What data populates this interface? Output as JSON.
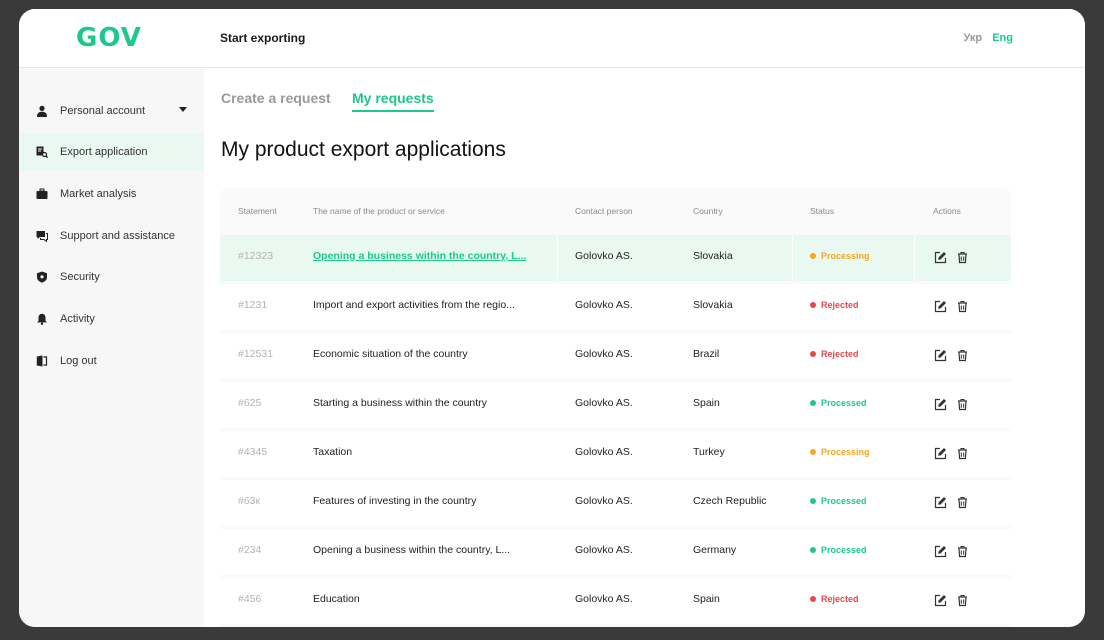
{
  "header": {
    "logo": "GOV",
    "title": "Start exporting",
    "lang_ukr": "Укр",
    "lang_eng": "Eng"
  },
  "sidebar": {
    "items": [
      {
        "label": "Personal account",
        "icon": "user-icon"
      },
      {
        "label": "Export application",
        "icon": "document-search-icon"
      },
      {
        "label": "Market analysis",
        "icon": "briefcase-icon"
      },
      {
        "label": "Support and assistance",
        "icon": "chat-icon"
      },
      {
        "label": "Security",
        "icon": "shield-icon"
      },
      {
        "label": "Activity",
        "icon": "bell-icon"
      },
      {
        "label": "Log out",
        "icon": "logout-icon"
      }
    ]
  },
  "tabs": {
    "create": "Create a request",
    "mine": "My requests"
  },
  "page": {
    "title": "My product export applications"
  },
  "table": {
    "headers": {
      "statement": "Statement",
      "name": "The name of the product or service",
      "contact": "Contact person",
      "country": "Country",
      "status": "Status",
      "actions": "Actions"
    },
    "rows": [
      {
        "id": "#12323",
        "name": "Opening a business within the country, L...",
        "contact": "Golovko AS.",
        "country": "Slovakia",
        "status": "Processing"
      },
      {
        "id": "#1231",
        "name": "Import and export activities from the regio...",
        "contact": "Golovko AS.",
        "country": "Slovakia",
        "status": "Rejected"
      },
      {
        "id": "#12531",
        "name": "Economic situation of the country",
        "contact": "Golovko AS.",
        "country": "Brazil",
        "status": "Rejected"
      },
      {
        "id": "#625",
        "name": "Starting a business within the country",
        "contact": "Golovko AS.",
        "country": "Spain",
        "status": "Processed"
      },
      {
        "id": "#4345",
        "name": "Taxation",
        "contact": "Golovko AS.",
        "country": "Turkey",
        "status": "Processing"
      },
      {
        "id": "#63к",
        "name": "Features of investing in the country",
        "contact": "Golovko AS.",
        "country": "Czech Republic",
        "status": "Processed"
      },
      {
        "id": "#234",
        "name": "Opening a business within the country, L...",
        "contact": "Golovko AS.",
        "country": "Germany",
        "status": "Processed"
      },
      {
        "id": "#456",
        "name": "Education",
        "contact": "Golovko AS.",
        "country": "Spain",
        "status": "Rejected"
      }
    ]
  },
  "colors": {
    "accent": "#1dc98a",
    "processing": "#f5a623",
    "rejected": "#e5484d",
    "processed": "#1dc98a"
  }
}
